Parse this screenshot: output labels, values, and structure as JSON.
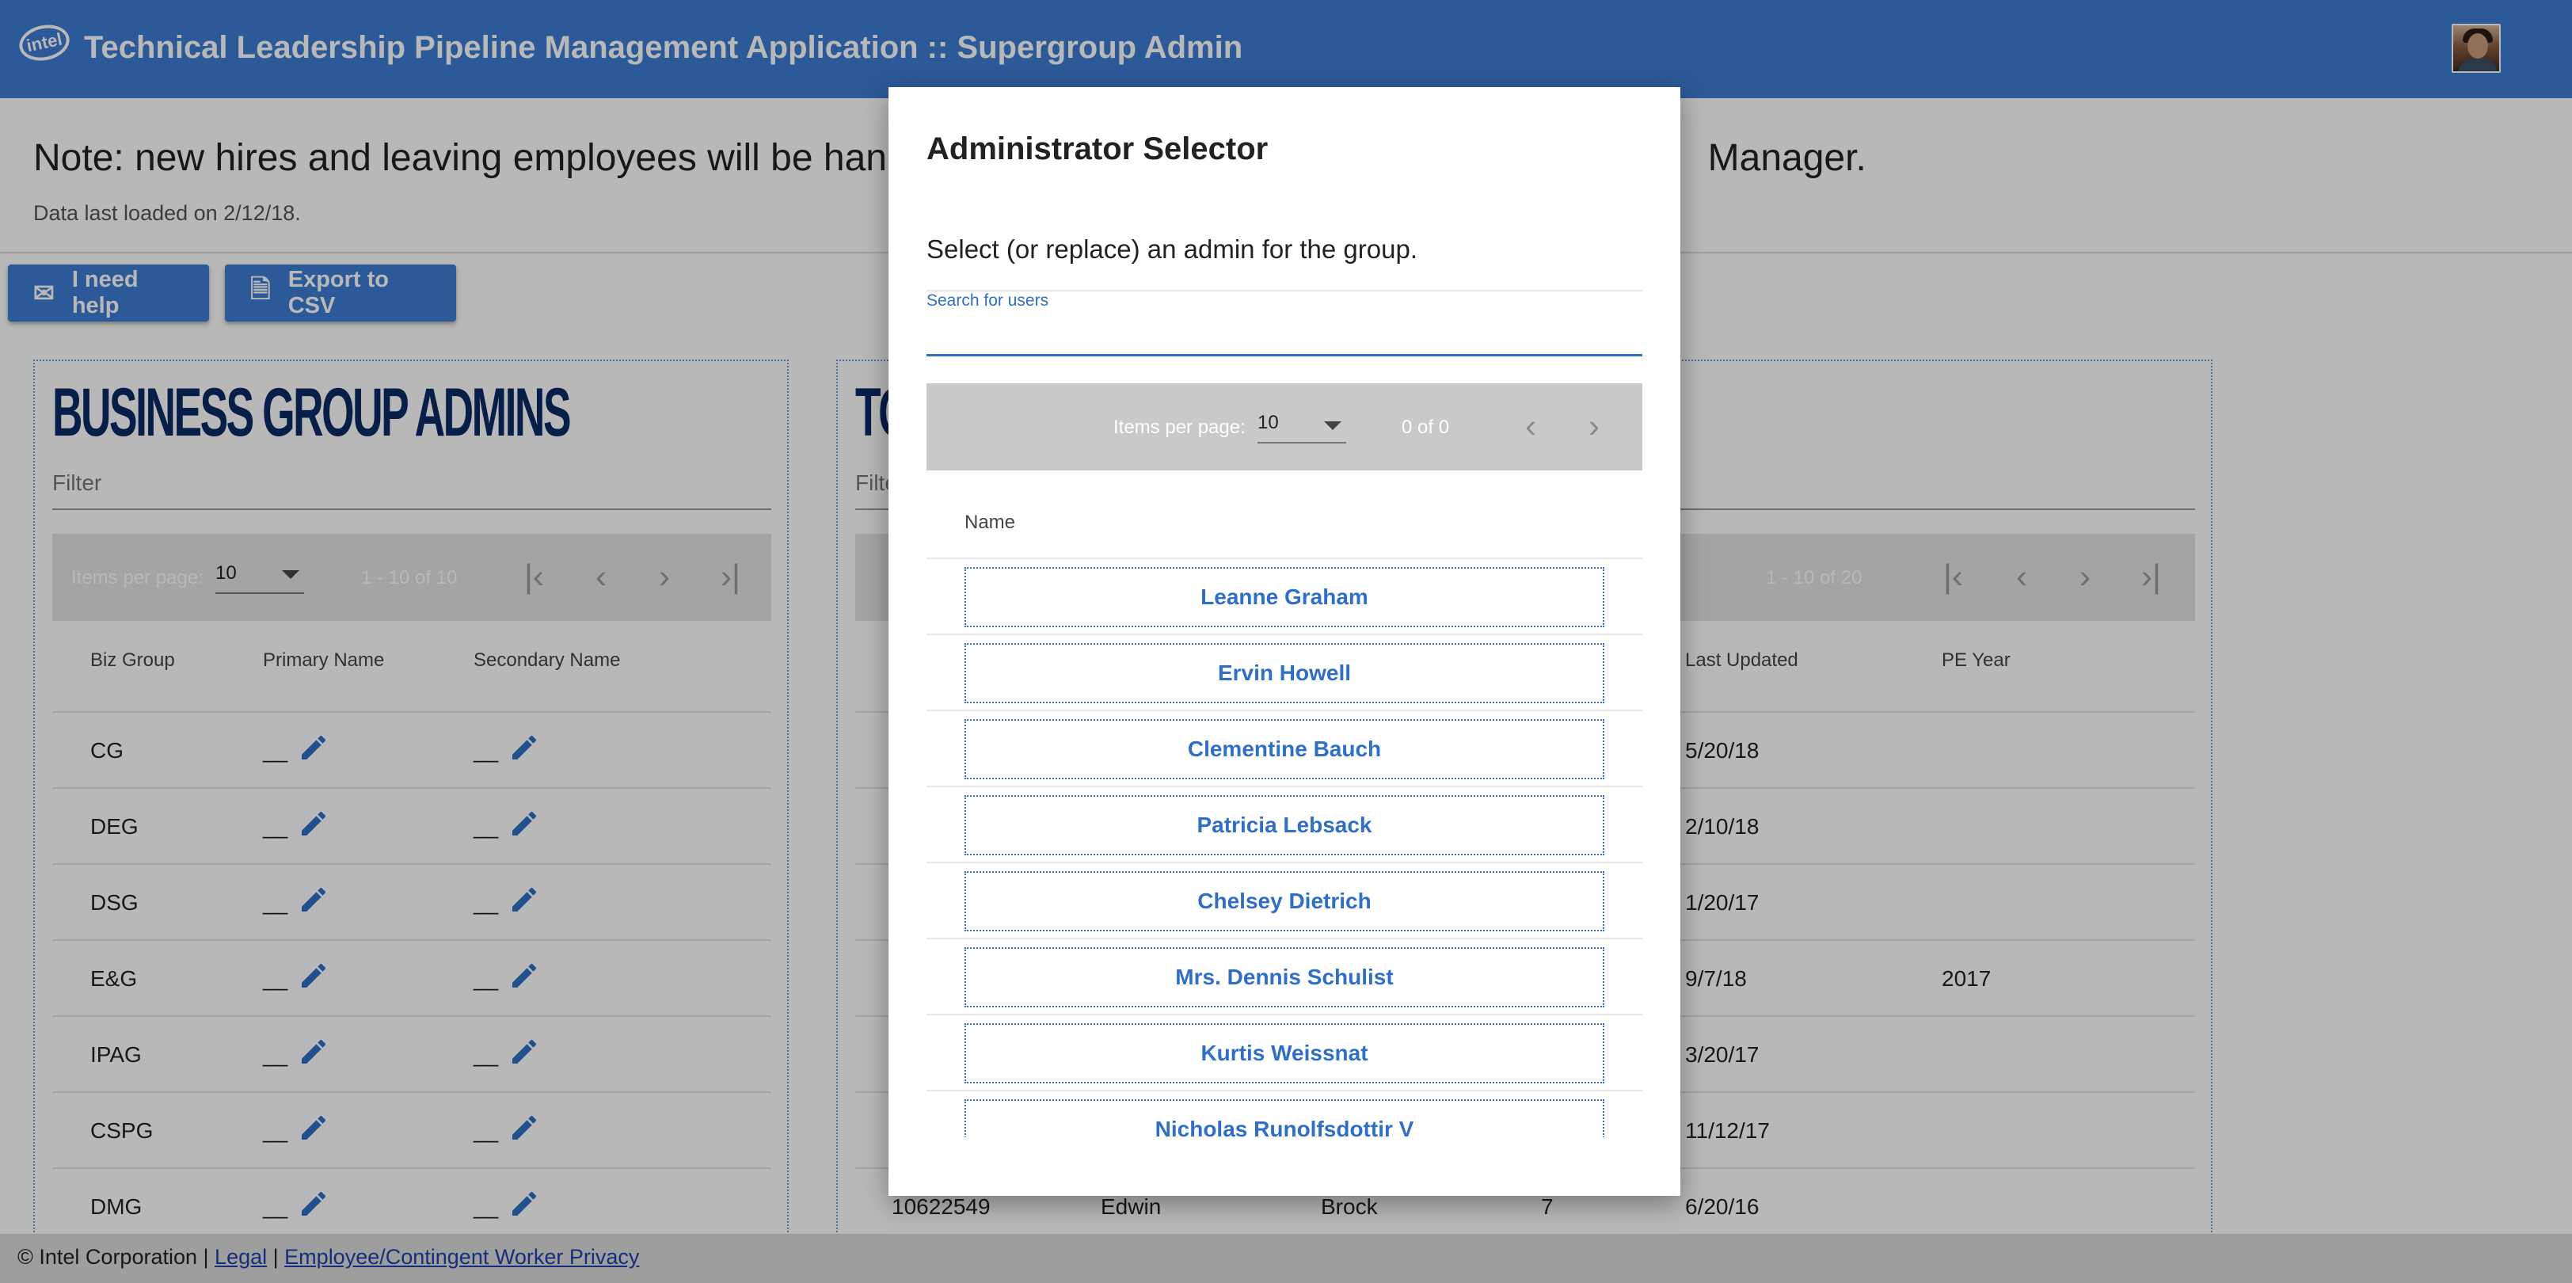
{
  "header": {
    "logo_text": "intel",
    "title": "Technical Leadership Pipeline Management Application :: Supergroup Admin"
  },
  "notice": {
    "text_visible_left": "Note: new hires and leaving employees will be hand",
    "text_visible_right": "Manager.",
    "data_loaded": "Data last loaded on 2/12/18."
  },
  "toolbar": {
    "help_label": "I need help",
    "export_label": "Export to CSV"
  },
  "left_card": {
    "title": "BUSINESS GROUP ADMINS",
    "filter_placeholder": "Filter",
    "pager": {
      "items_per_page_label": "Items per page:",
      "items_per_page": "10",
      "range": "1 - 10 of 10"
    },
    "columns": [
      "Biz Group",
      "Primary Name",
      "Secondary Name"
    ],
    "rows": [
      {
        "group": "CG",
        "primary": "__",
        "secondary": "__"
      },
      {
        "group": "DEG",
        "primary": "__",
        "secondary": "__"
      },
      {
        "group": "DSG",
        "primary": "__",
        "secondary": "__"
      },
      {
        "group": "E&G",
        "primary": "__",
        "secondary": "__"
      },
      {
        "group": "IPAG",
        "primary": "__",
        "secondary": "__"
      },
      {
        "group": "CSPG",
        "primary": "__",
        "secondary": "__"
      },
      {
        "group": "DMG",
        "primary": "__",
        "secondary": "__"
      }
    ]
  },
  "right_card": {
    "title_visible": "TO",
    "filter_placeholder": "Filte",
    "pager": {
      "range": "1 - 10 of 20"
    },
    "columns": [
      "Last Updated",
      "PE Year"
    ],
    "rows": [
      {
        "last_updated": "5/20/18",
        "pe_year": ""
      },
      {
        "last_updated": "2/10/18",
        "pe_year": ""
      },
      {
        "last_updated": "1/20/17",
        "pe_year": ""
      },
      {
        "last_updated": "9/7/18",
        "pe_year": "2017"
      },
      {
        "last_updated": "3/20/17",
        "pe_year": ""
      },
      {
        "last_updated": "11/12/17",
        "pe_year": ""
      },
      {
        "id": "10622549",
        "first": "Edwin",
        "last": "Brock",
        "level": "7",
        "last_updated": "6/20/16",
        "pe_year": ""
      }
    ]
  },
  "footer": {
    "copyright": "© Intel Corporation |",
    "sep": "|",
    "legal": "Legal",
    "privacy": "Employee/Contingent Worker Privacy"
  },
  "dialog": {
    "title": "Administrator Selector",
    "description": "Select (or replace) an admin for the group.",
    "search_label": "Search for users",
    "search_value": "",
    "pager": {
      "items_per_page_label": "Items per page:",
      "items_per_page": "10",
      "range": "0 of 0"
    },
    "column": "Name",
    "users": [
      "Leanne Graham",
      "Ervin Howell",
      "Clementine Bauch",
      "Patricia Lebsack",
      "Chelsey Dietrich",
      "Mrs. Dennis Schulist",
      "Kurtis Weissnat",
      "Nicholas Runolfsdottir V"
    ]
  }
}
